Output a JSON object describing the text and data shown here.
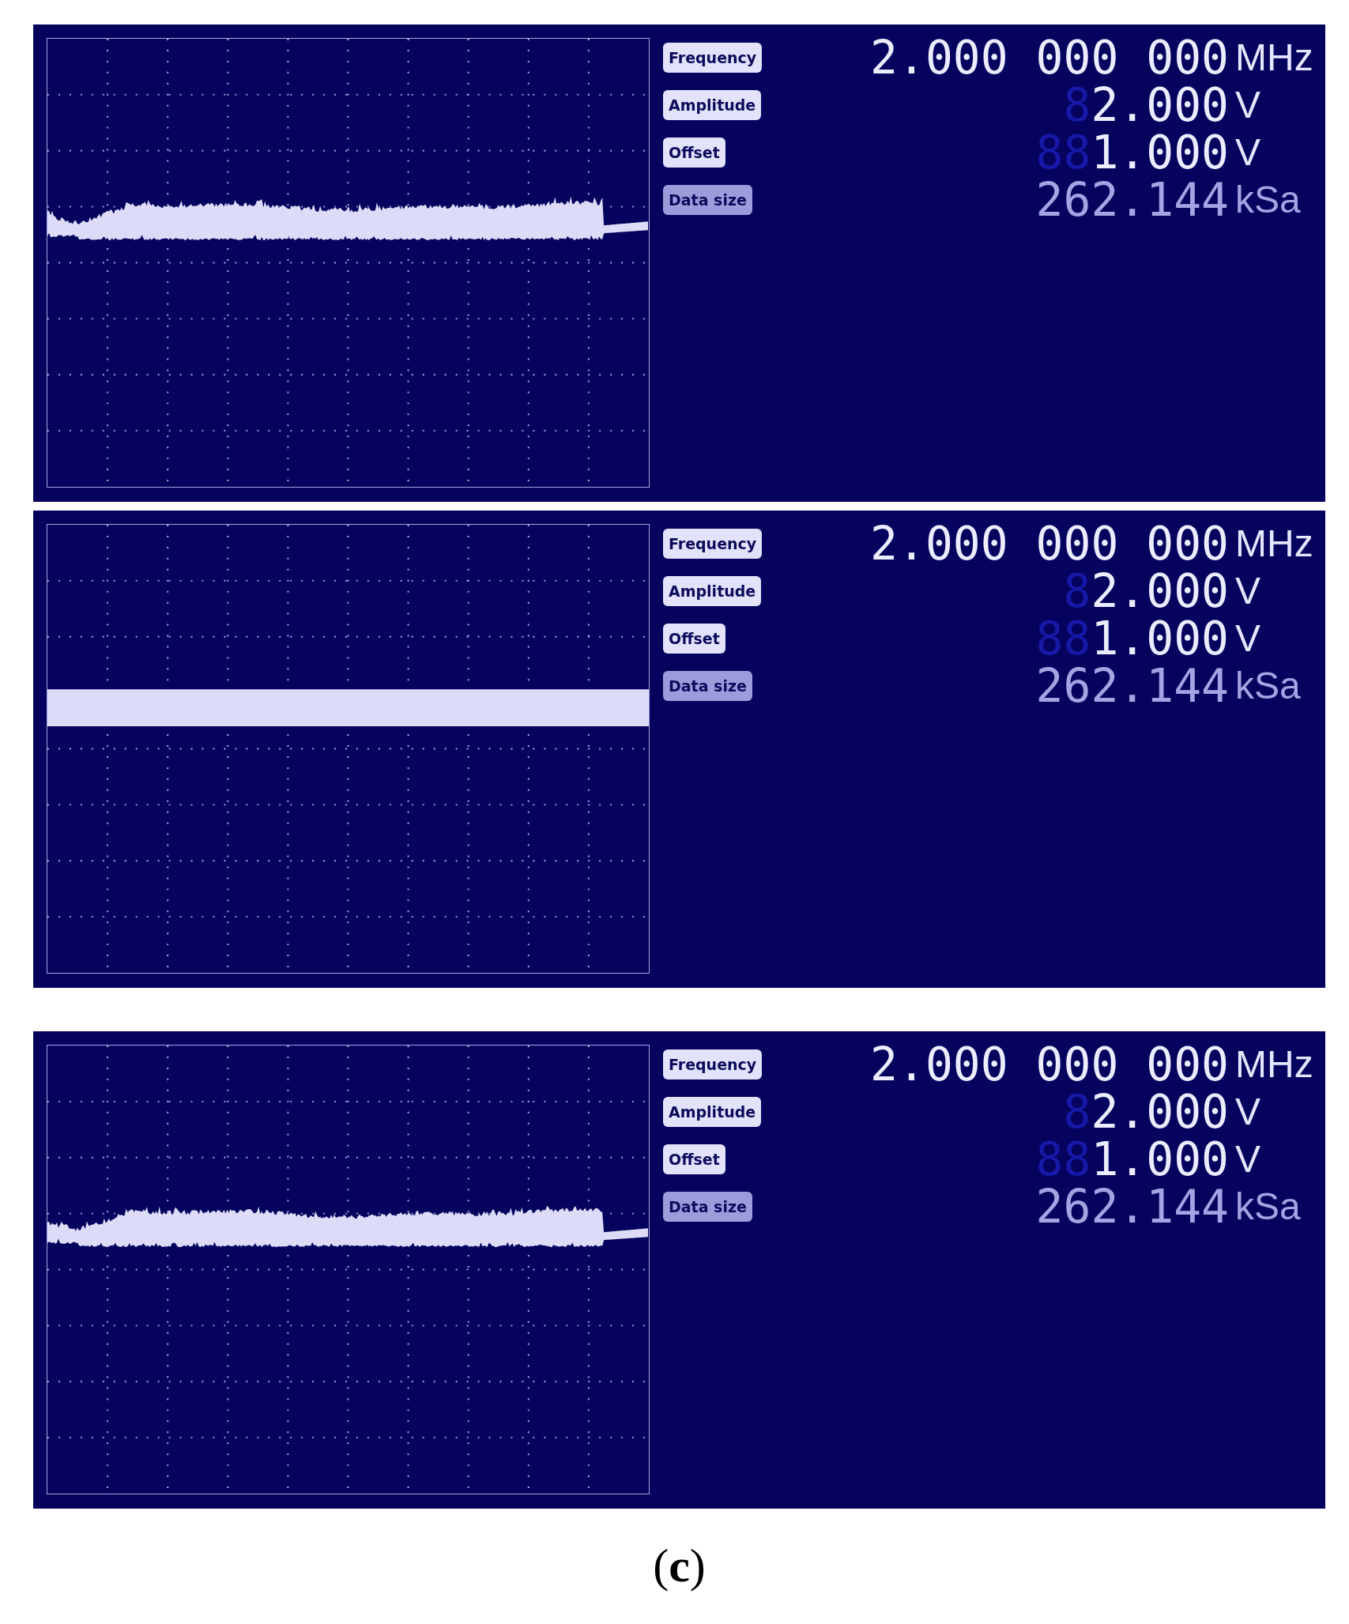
{
  "panels": [
    {
      "trace": {
        "kind": "noisy"
      },
      "parameters": [
        {
          "label": "Frequency",
          "value": "2.000 000 000",
          "unit": "MHz",
          "disabled": false
        },
        {
          "label": "Amplitude",
          "unlit": "8",
          "value": "2.000",
          "unit": "V",
          "disabled": false
        },
        {
          "label": "Offset",
          "unlit": "88",
          "value": "1.000",
          "unit": "V",
          "disabled": false
        },
        {
          "label": "Data size",
          "value": "262.144",
          "unit": "kSa",
          "disabled": true
        }
      ]
    },
    {
      "trace": {
        "kind": "steady"
      },
      "parameters": [
        {
          "label": "Frequency",
          "value": "2.000 000 000",
          "unit": "MHz",
          "disabled": false
        },
        {
          "label": "Amplitude",
          "unlit": "8",
          "value": "2.000",
          "unit": "V",
          "disabled": false
        },
        {
          "label": "Offset",
          "unlit": "88",
          "value": "1.000",
          "unit": "V",
          "disabled": false
        },
        {
          "label": "Data size",
          "value": "262.144",
          "unit": "kSa",
          "disabled": true
        }
      ]
    },
    {
      "trace": {
        "kind": "noisy"
      },
      "parameters": [
        {
          "label": "Frequency",
          "value": "2.000 000 000",
          "unit": "MHz",
          "disabled": false
        },
        {
          "label": "Amplitude",
          "unlit": "8",
          "value": "2.000",
          "unit": "V",
          "disabled": false
        },
        {
          "label": "Offset",
          "unlit": "88",
          "value": "1.000",
          "unit": "V",
          "disabled": false
        },
        {
          "label": "Data size",
          "value": "262.144",
          "unit": "kSa",
          "disabled": true
        }
      ]
    }
  ],
  "caption": "(**c**)"
}
